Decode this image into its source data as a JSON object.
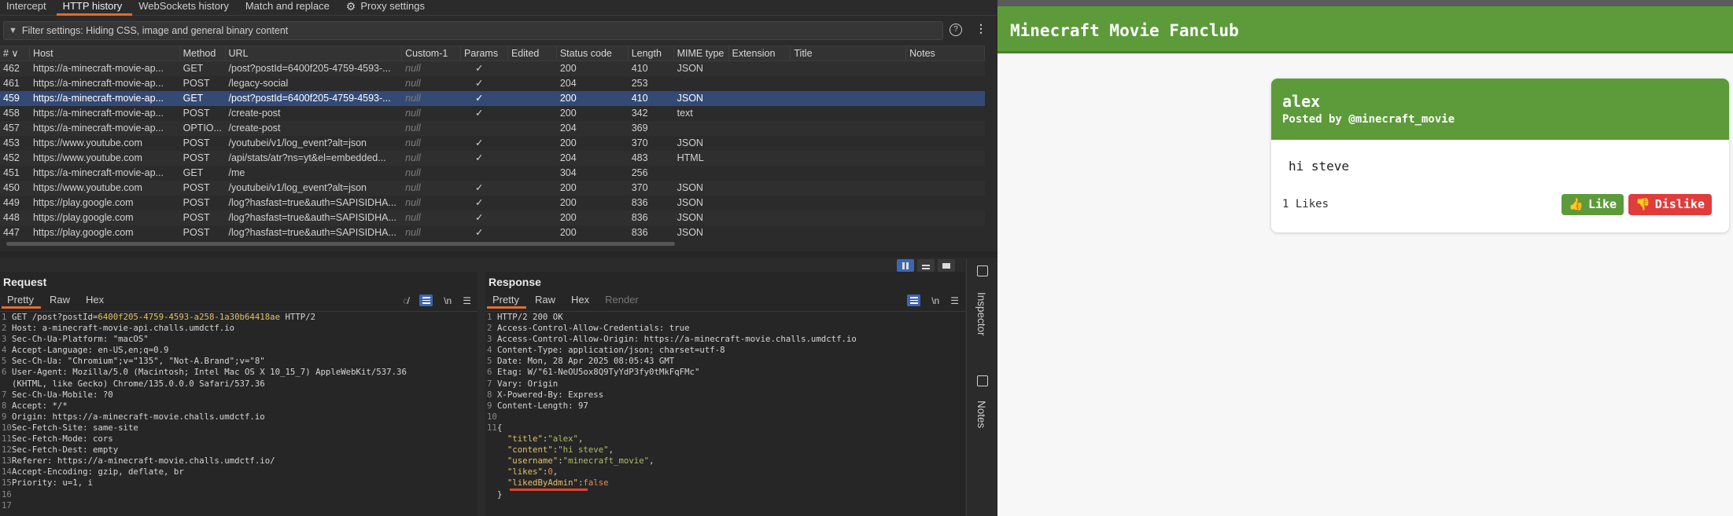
{
  "burp": {
    "tabs": [
      "Intercept",
      "HTTP history",
      "WebSockets history",
      "Match and replace",
      "Proxy settings"
    ],
    "active_tab": "HTTP history",
    "filter_text": "Filter settings: Hiding CSS, image and general binary content",
    "columns": [
      "# ∨",
      "Host",
      "Method",
      "URL",
      "Custom-1",
      "Params",
      "Edited",
      "Status code",
      "Length",
      "MIME type",
      "Extension",
      "Title",
      "Notes"
    ],
    "rows": [
      {
        "num": "462",
        "host": "https://a-minecraft-movie-ap...",
        "method": "GET",
        "url": "/post?postId=6400f205-4759-4593-...",
        "custom": "null",
        "params": "✓",
        "edited": "",
        "status": "200",
        "length": "410",
        "mime": "JSON",
        "ext": "",
        "title": "",
        "notes": ""
      },
      {
        "num": "461",
        "host": "https://a-minecraft-movie-ap...",
        "method": "POST",
        "url": "/legacy-social",
        "custom": "null",
        "params": "✓",
        "edited": "",
        "status": "204",
        "length": "253",
        "mime": "",
        "ext": "",
        "title": "",
        "notes": ""
      },
      {
        "num": "459",
        "host": "https://a-minecraft-movie-ap...",
        "method": "GET",
        "url": "/post?postId=6400f205-4759-4593-...",
        "custom": "null",
        "params": "✓",
        "edited": "",
        "status": "200",
        "length": "410",
        "mime": "JSON",
        "ext": "",
        "title": "",
        "notes": ""
      },
      {
        "num": "458",
        "host": "https://a-minecraft-movie-ap...",
        "method": "POST",
        "url": "/create-post",
        "custom": "null",
        "params": "✓",
        "edited": "",
        "status": "200",
        "length": "342",
        "mime": "text",
        "ext": "",
        "title": "",
        "notes": ""
      },
      {
        "num": "457",
        "host": "https://a-minecraft-movie-ap...",
        "method": "OPTIO...",
        "url": "/create-post",
        "custom": "null",
        "params": "",
        "edited": "",
        "status": "204",
        "length": "369",
        "mime": "",
        "ext": "",
        "title": "",
        "notes": ""
      },
      {
        "num": "453",
        "host": "https://www.youtube.com",
        "method": "POST",
        "url": "/youtubei/v1/log_event?alt=json",
        "custom": "null",
        "params": "✓",
        "edited": "",
        "status": "200",
        "length": "370",
        "mime": "JSON",
        "ext": "",
        "title": "",
        "notes": ""
      },
      {
        "num": "452",
        "host": "https://www.youtube.com",
        "method": "POST",
        "url": "/api/stats/atr?ns=yt&el=embedded...",
        "custom": "null",
        "params": "✓",
        "edited": "",
        "status": "204",
        "length": "483",
        "mime": "HTML",
        "ext": "",
        "title": "",
        "notes": ""
      },
      {
        "num": "451",
        "host": "https://a-minecraft-movie-ap...",
        "method": "GET",
        "url": "/me",
        "custom": "null",
        "params": "",
        "edited": "",
        "status": "304",
        "length": "256",
        "mime": "",
        "ext": "",
        "title": "",
        "notes": ""
      },
      {
        "num": "450",
        "host": "https://www.youtube.com",
        "method": "POST",
        "url": "/youtubei/v1/log_event?alt=json",
        "custom": "null",
        "params": "✓",
        "edited": "",
        "status": "200",
        "length": "370",
        "mime": "JSON",
        "ext": "",
        "title": "",
        "notes": ""
      },
      {
        "num": "449",
        "host": "https://play.google.com",
        "method": "POST",
        "url": "/log?hasfast=true&auth=SAPISIDHA...",
        "custom": "null",
        "params": "✓",
        "edited": "",
        "status": "200",
        "length": "836",
        "mime": "JSON",
        "ext": "",
        "title": "",
        "notes": ""
      },
      {
        "num": "448",
        "host": "https://play.google.com",
        "method": "POST",
        "url": "/log?hasfast=true&auth=SAPISIDHA...",
        "custom": "null",
        "params": "✓",
        "edited": "",
        "status": "200",
        "length": "836",
        "mime": "JSON",
        "ext": "",
        "title": "",
        "notes": ""
      },
      {
        "num": "447",
        "host": "https://play.google.com",
        "method": "POST",
        "url": "/log?hasfast=true&auth=SAPISIDHA...",
        "custom": "null",
        "params": "✓",
        "edited": "",
        "status": "200",
        "length": "836",
        "mime": "JSON",
        "ext": "",
        "title": "",
        "notes": ""
      }
    ],
    "selected_row": "459",
    "request": {
      "title": "Request",
      "tabs": [
        "Pretty",
        "Raw",
        "Hex"
      ],
      "wrap_label": "\\n",
      "lines": [
        {
          "n": "1",
          "t": "GET /post?postId=",
          "hl": "6400f205-4759-4593-a258-1a30b64418ae",
          "tail": " HTTP/2"
        },
        {
          "n": "2",
          "t": "Host: a-minecraft-movie-api.challs.umdctf.io"
        },
        {
          "n": "3",
          "t": "Sec-Ch-Ua-Platform: \"macOS\""
        },
        {
          "n": "4",
          "t": "Accept-Language: en-US,en;q=0.9"
        },
        {
          "n": "5",
          "t": "Sec-Ch-Ua: \"Chromium\";v=\"135\", \"Not-A.Brand\";v=\"8\""
        },
        {
          "n": "6",
          "t": "User-Agent: Mozilla/5.0 (Macintosh; Intel Mac OS X 10_15_7) AppleWebKit/537.36"
        },
        {
          "n": "",
          "t": "(KHTML, like Gecko) Chrome/135.0.0.0 Safari/537.36"
        },
        {
          "n": "7",
          "t": "Sec-Ch-Ua-Mobile: ?0"
        },
        {
          "n": "8",
          "t": "Accept: */*"
        },
        {
          "n": "9",
          "t": "Origin: https://a-minecraft-movie.challs.umdctf.io"
        },
        {
          "n": "10",
          "t": "Sec-Fetch-Site: same-site"
        },
        {
          "n": "11",
          "t": "Sec-Fetch-Mode: cors"
        },
        {
          "n": "12",
          "t": "Sec-Fetch-Dest: empty"
        },
        {
          "n": "13",
          "t": "Referer: https://a-minecraft-movie.challs.umdctf.io/"
        },
        {
          "n": "14",
          "t": "Accept-Encoding: gzip, deflate, br"
        },
        {
          "n": "15",
          "t": "Priority: u=1, i"
        },
        {
          "n": "16",
          "t": ""
        },
        {
          "n": "17",
          "t": ""
        }
      ]
    },
    "response": {
      "title": "Response",
      "tabs": [
        "Pretty",
        "Raw",
        "Hex",
        "Render"
      ],
      "wrap_label": "\\n",
      "lines": [
        {
          "n": "1",
          "t": "HTTP/2 200 OK"
        },
        {
          "n": "2",
          "t": "Access-Control-Allow-Credentials: true"
        },
        {
          "n": "3",
          "t": "Access-Control-Allow-Origin: https://a-minecraft-movie.challs.umdctf.io"
        },
        {
          "n": "4",
          "t": "Content-Type: application/json; charset=utf-8"
        },
        {
          "n": "5",
          "t": "Date: Mon, 28 Apr 2025 08:05:43 GMT"
        },
        {
          "n": "6",
          "t": "Etag: W/\"61-NeOU5ox8Q9TyYdP3fy0tMkFqFMc\""
        },
        {
          "n": "7",
          "t": "Vary: Origin"
        },
        {
          "n": "8",
          "t": "X-Powered-By: Express"
        },
        {
          "n": "9",
          "t": "Content-Length: 97"
        },
        {
          "n": "10",
          "t": ""
        },
        {
          "n": "11",
          "t": "{"
        }
      ],
      "json": [
        {
          "k": "\"title\"",
          "v": "\"alex\"",
          "type": "s"
        },
        {
          "k": "\"content\"",
          "v": "\"hi steve\"",
          "type": "s"
        },
        {
          "k": "\"username\"",
          "v": "\"minecraft_movie\"",
          "type": "s"
        },
        {
          "k": "\"likes\"",
          "v": "0",
          "type": "n"
        },
        {
          "k": "\"likedByAdmin\"",
          "v": "false",
          "type": "n"
        }
      ],
      "close": "}"
    },
    "side_tabs": [
      "Inspector",
      "Notes"
    ],
    "accent": "#e06c2e",
    "selection": "#344a75"
  },
  "site": {
    "title": "Minecraft Movie Fanclub",
    "card": {
      "title": "alex",
      "byline": "Posted by @minecraft_movie",
      "content": "hi steve",
      "likes": "1 Likes",
      "like_label": "Like",
      "dislike_label": "Dislike",
      "like_emoji": "👍",
      "dislike_emoji": "👎"
    },
    "brand_green": "#5d9b3a",
    "dislike_red": "#e03c3c"
  }
}
